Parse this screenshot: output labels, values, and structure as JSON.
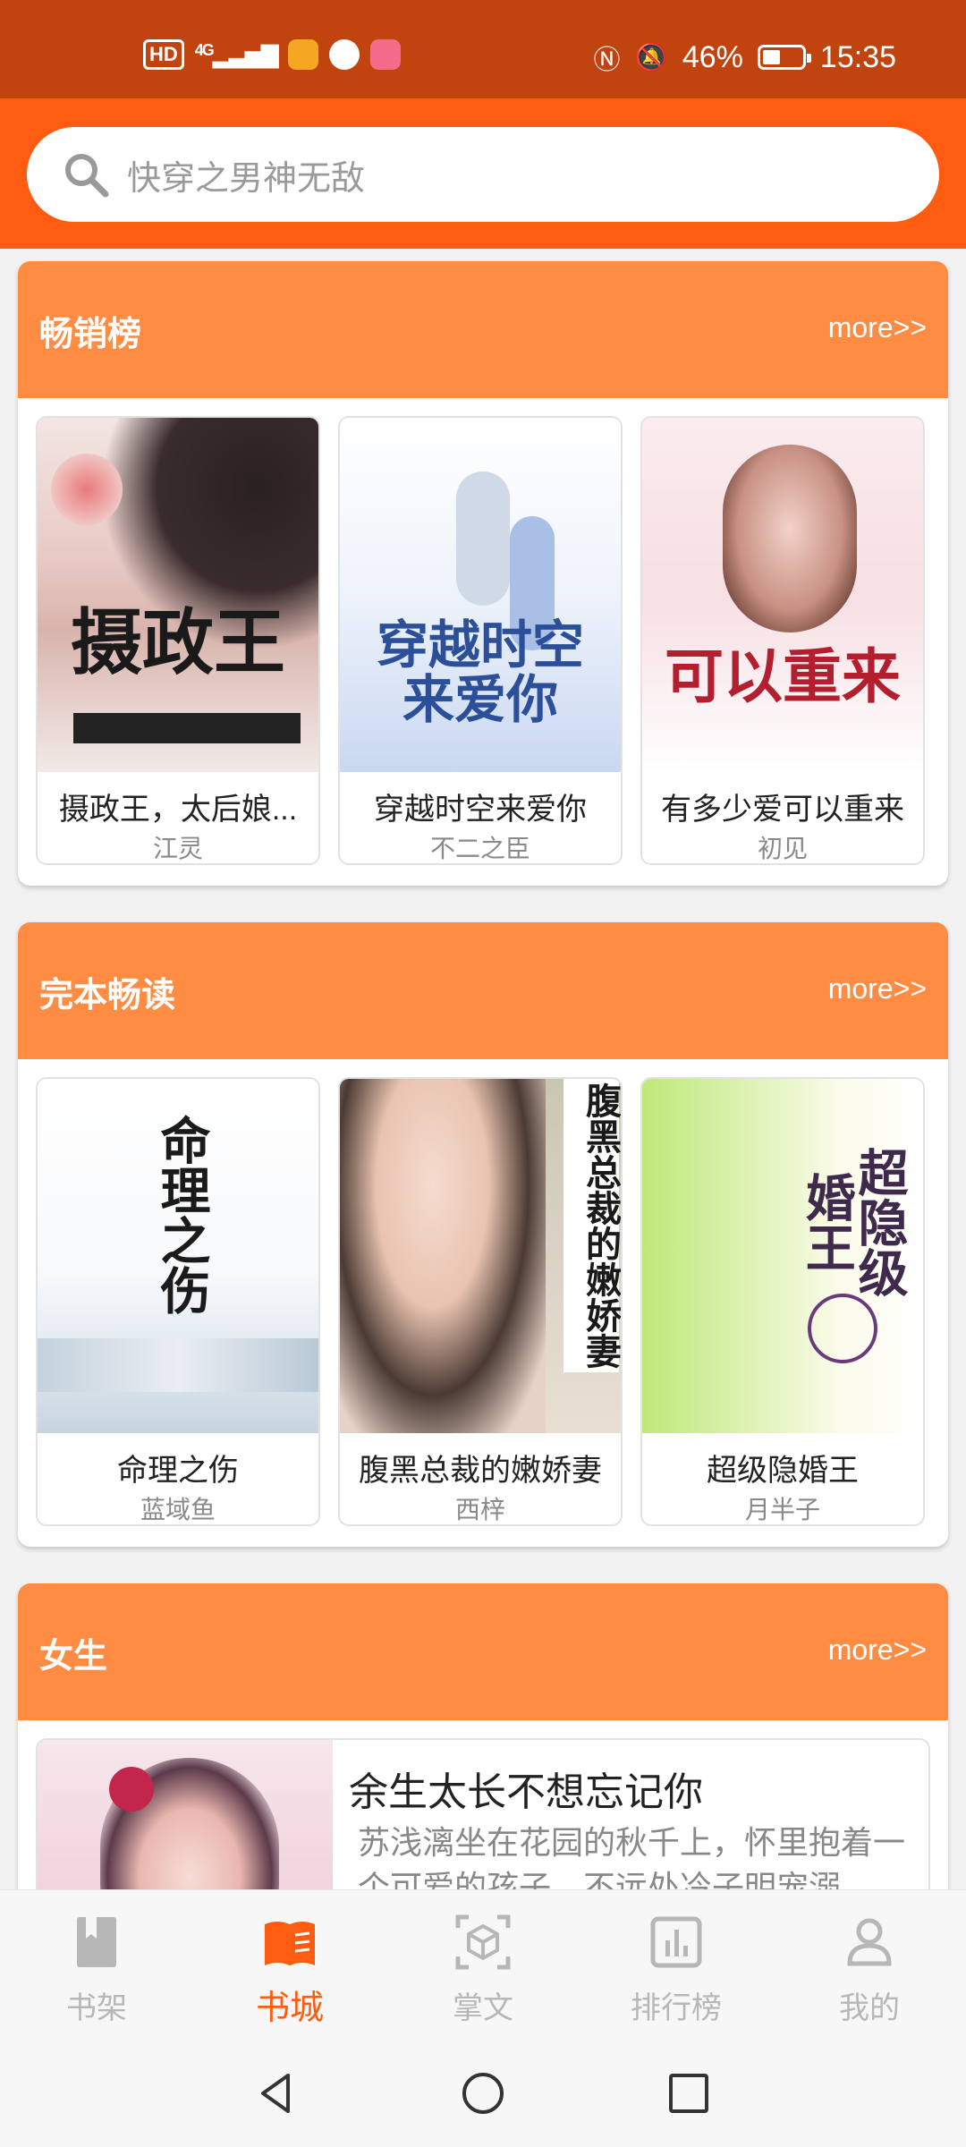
{
  "status_bar": {
    "time": "15:35",
    "battery": "46%",
    "battery_level": 0.46,
    "hd": "HD",
    "network": "4G",
    "icons": [
      "nfc-icon",
      "bell-off-icon",
      "battery-icon",
      "signal-icon"
    ]
  },
  "search": {
    "placeholder": "快穿之男神无敌"
  },
  "sections": [
    {
      "title": "畅销榜",
      "more": "more>>",
      "books": [
        {
          "title": "摄政王，太后娘...",
          "author": "江灵",
          "cover_text": "摄政王"
        },
        {
          "title": "穿越时空来爱你",
          "author": "不二之臣",
          "cover_text": "穿越时空来爱你"
        },
        {
          "title": "有多少爱可以重来",
          "author": "初见",
          "cover_text": "可以重来"
        }
      ]
    },
    {
      "title": "完本畅读",
      "more": "more>>",
      "books": [
        {
          "title": "命理之伤",
          "author": "蓝域鱼",
          "cover_text": "命理之伤"
        },
        {
          "title": "腹黑总裁的嫩娇妻",
          "author": "西梓",
          "cover_text": "腹黑总裁的嫩娇妻"
        },
        {
          "title": "超级隐婚王",
          "author": "月半子",
          "cover_text": "超隐级婚王"
        }
      ]
    },
    {
      "title": "女生",
      "more": "more>>",
      "featured": {
        "title": "余生太长不想忘记你",
        "desc": "苏浅漓坐在花园的秋千上，怀里抱着一个可爱的孩子，不远处冷子明宠溺"
      }
    }
  ],
  "bottom_nav": [
    {
      "label": "书架",
      "icon": "bookmark-icon",
      "active": false
    },
    {
      "label": "书城",
      "icon": "book-open-icon",
      "active": true
    },
    {
      "label": "掌文",
      "icon": "cube-scan-icon",
      "active": false
    },
    {
      "label": "排行榜",
      "icon": "bar-chart-icon",
      "active": false
    },
    {
      "label": "我的",
      "icon": "user-icon",
      "active": false
    }
  ],
  "colors": {
    "status_bar": "#c1440e",
    "header": "#ff5c12",
    "section_head": "#ff8c42",
    "active": "#ff5c12"
  }
}
